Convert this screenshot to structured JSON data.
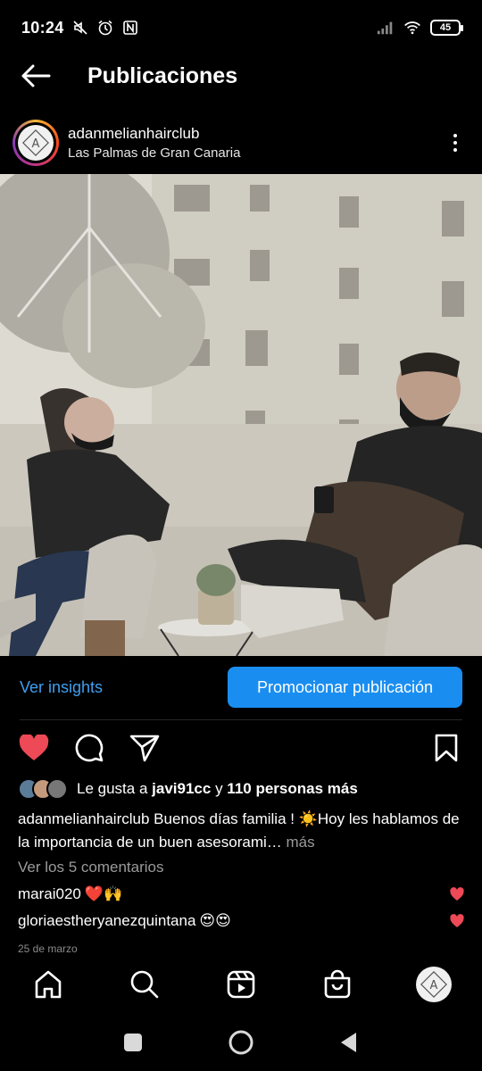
{
  "status_bar": {
    "time": "10:24",
    "battery": "45",
    "icons": [
      "mute-icon",
      "alarm-icon",
      "nfc-icon",
      "signal-icon",
      "wifi-icon",
      "battery-icon"
    ]
  },
  "header": {
    "title": "Publicaciones",
    "back_icon": "arrow-left-icon"
  },
  "post": {
    "username": "adanmelianhairclub",
    "location": "Las Palmas de Gran Canaria",
    "avatar_letter": "A"
  },
  "actions": {
    "insights_label": "Ver insights",
    "promote_label": "Promocionar publicación"
  },
  "likes": {
    "prefix": "Le gusta a",
    "user": "javi91cc",
    "connector": "y",
    "others": "110 personas más"
  },
  "caption": {
    "user": "adanmelianhairclub",
    "text": "Buenos días familia ! ☀️Hoy les hablamos de la importancia de un buen asesorami…",
    "more": "más"
  },
  "view_comments": "Ver los 5 comentarios",
  "comments": [
    {
      "user": "marai020",
      "text": "❤️🙌"
    },
    {
      "user": "gloriaestheryanezquintana",
      "text": "😍😍"
    }
  ],
  "date": "25 de marzo",
  "colors": {
    "accent": "#1a8ef0",
    "link": "#3f9ff0",
    "like_red": "#ed4956",
    "background": "#000000"
  },
  "bottom_nav": [
    "home-icon",
    "search-icon",
    "reels-icon",
    "shop-icon",
    "profile-avatar"
  ]
}
